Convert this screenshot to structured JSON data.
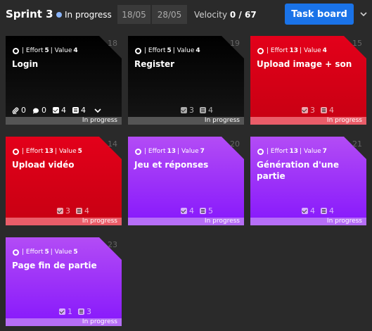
{
  "header": {
    "sprint_title": "Sprint 3",
    "status": "In progress",
    "date_start": "18/05",
    "date_end": "28/05",
    "velocity_label": "Velocity",
    "velocity_value": "0 / 67",
    "task_board_label": "Task board"
  },
  "colors": {
    "black": "#000000",
    "red": "#e3001a",
    "purple": "#a13cf7",
    "accent": "#1a73e8"
  },
  "cards": [
    {
      "num": "18",
      "effort_label": "| Effort",
      "effort": "5",
      "value_label": "| Value",
      "value": "4",
      "title": "Login",
      "attachments": "0",
      "comments": "0",
      "checks": "4",
      "lists": "4",
      "footer": "In progress"
    },
    {
      "num": "19",
      "effort_label": "| Effort",
      "effort": "5",
      "value_label": "| Value",
      "value": "4",
      "title": "Register",
      "checks": "3",
      "lists": "4",
      "footer": "In progress"
    },
    {
      "num": "15",
      "effort_label": "| Effort",
      "effort": "13",
      "value_label": "| Value",
      "value": "4",
      "title": "Upload image + son",
      "checks": "3",
      "lists": "4",
      "footer": "In progress"
    },
    {
      "num": "14",
      "effort_label": "| Effort",
      "effort": "13",
      "value_label": "| Value",
      "value": "5",
      "title": "Upload vidéo",
      "checks": "3",
      "lists": "4",
      "footer": "In progress"
    },
    {
      "num": "20",
      "effort_label": "| Effort",
      "effort": "13",
      "value_label": "| Value",
      "value": "7",
      "title": "Jeu et réponses",
      "checks": "4",
      "lists": "5",
      "footer": "In progress"
    },
    {
      "num": "21",
      "effort_label": "| Effort",
      "effort": "13",
      "value_label": "| Value",
      "value": "7",
      "title": "Génération d'une partie",
      "checks": "4",
      "lists": "4",
      "footer": "In progress"
    },
    {
      "num": "23",
      "effort_label": "| Effort",
      "effort": "5",
      "value_label": "| Value",
      "value": "5",
      "title": "Page fin de partie",
      "checks": "1",
      "lists": "3",
      "footer": "In progress"
    }
  ]
}
